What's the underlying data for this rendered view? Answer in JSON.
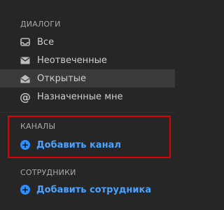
{
  "sections": {
    "dialogs": {
      "heading": "ДИАЛОГИ",
      "items": [
        {
          "label": "Все",
          "icon": "inbox-icon"
        },
        {
          "label": "Неотвеченные",
          "icon": "envelope-icon"
        },
        {
          "label": "Открытые",
          "icon": "open-envelope-icon",
          "active": true
        },
        {
          "label": "Назначенные мне",
          "icon": "at-icon"
        }
      ]
    },
    "channels": {
      "heading": "КАНАЛЫ",
      "action_label": "Добавить канал"
    },
    "employees": {
      "heading": "СОТРУДНИКИ",
      "action_label": "Добавить сотрудника"
    }
  },
  "colors": {
    "background": "#262626",
    "active_row": "#3a3a3a",
    "accent": "#2f8fff",
    "highlight": "#e00000"
  }
}
